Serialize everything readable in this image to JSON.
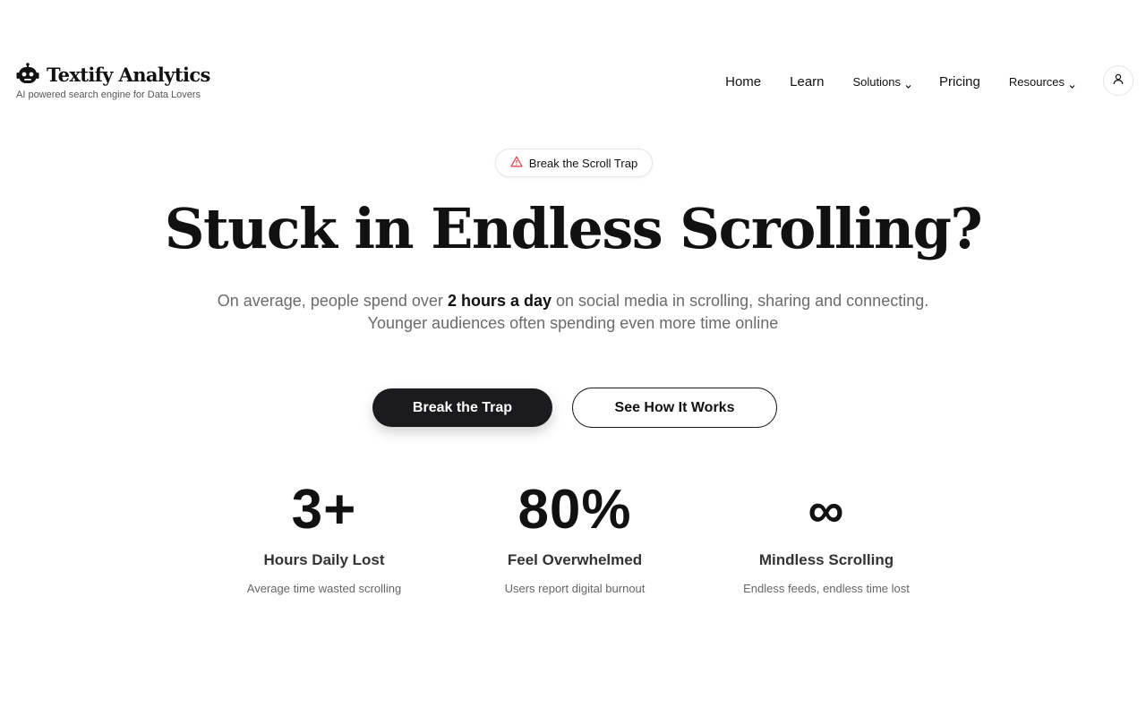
{
  "brand": {
    "name": "Textify Analytics",
    "tagline": "AI powered search engine for Data Lovers"
  },
  "nav": {
    "items": [
      {
        "label": "Home"
      },
      {
        "label": "Learn"
      },
      {
        "label": "Solutions"
      },
      {
        "label": "Pricing"
      },
      {
        "label": "Resources"
      }
    ]
  },
  "icons": {
    "logo": "robot-icon",
    "badge": "warning-triangle-icon",
    "user": "user-icon",
    "dropdown": "chevron-down-icon"
  },
  "colors": {
    "text": "#111111",
    "muted": "#6b6b6b",
    "primary_button": "#1b1b1d",
    "warning": "#e5484d"
  },
  "hero": {
    "badge": "Break the Scroll Trap",
    "title": "Stuck in Endless Scrolling?",
    "subtitle_before": "On average, people spend over ",
    "subtitle_emphasis": "2 hours a day",
    "subtitle_after": " on social media in scrolling, sharing and connecting. Younger audiences often spending even more time online",
    "primary_cta": "Break the Trap",
    "secondary_cta": "See How It Works"
  },
  "stats": [
    {
      "value": "3+",
      "label": "Hours Daily Lost",
      "description": "Average time wasted scrolling"
    },
    {
      "value": "80%",
      "label": "Feel Overwhelmed",
      "description": "Users report digital burnout"
    },
    {
      "value": "∞",
      "label": "Mindless Scrolling",
      "description": "Endless feeds, endless time lost"
    }
  ]
}
